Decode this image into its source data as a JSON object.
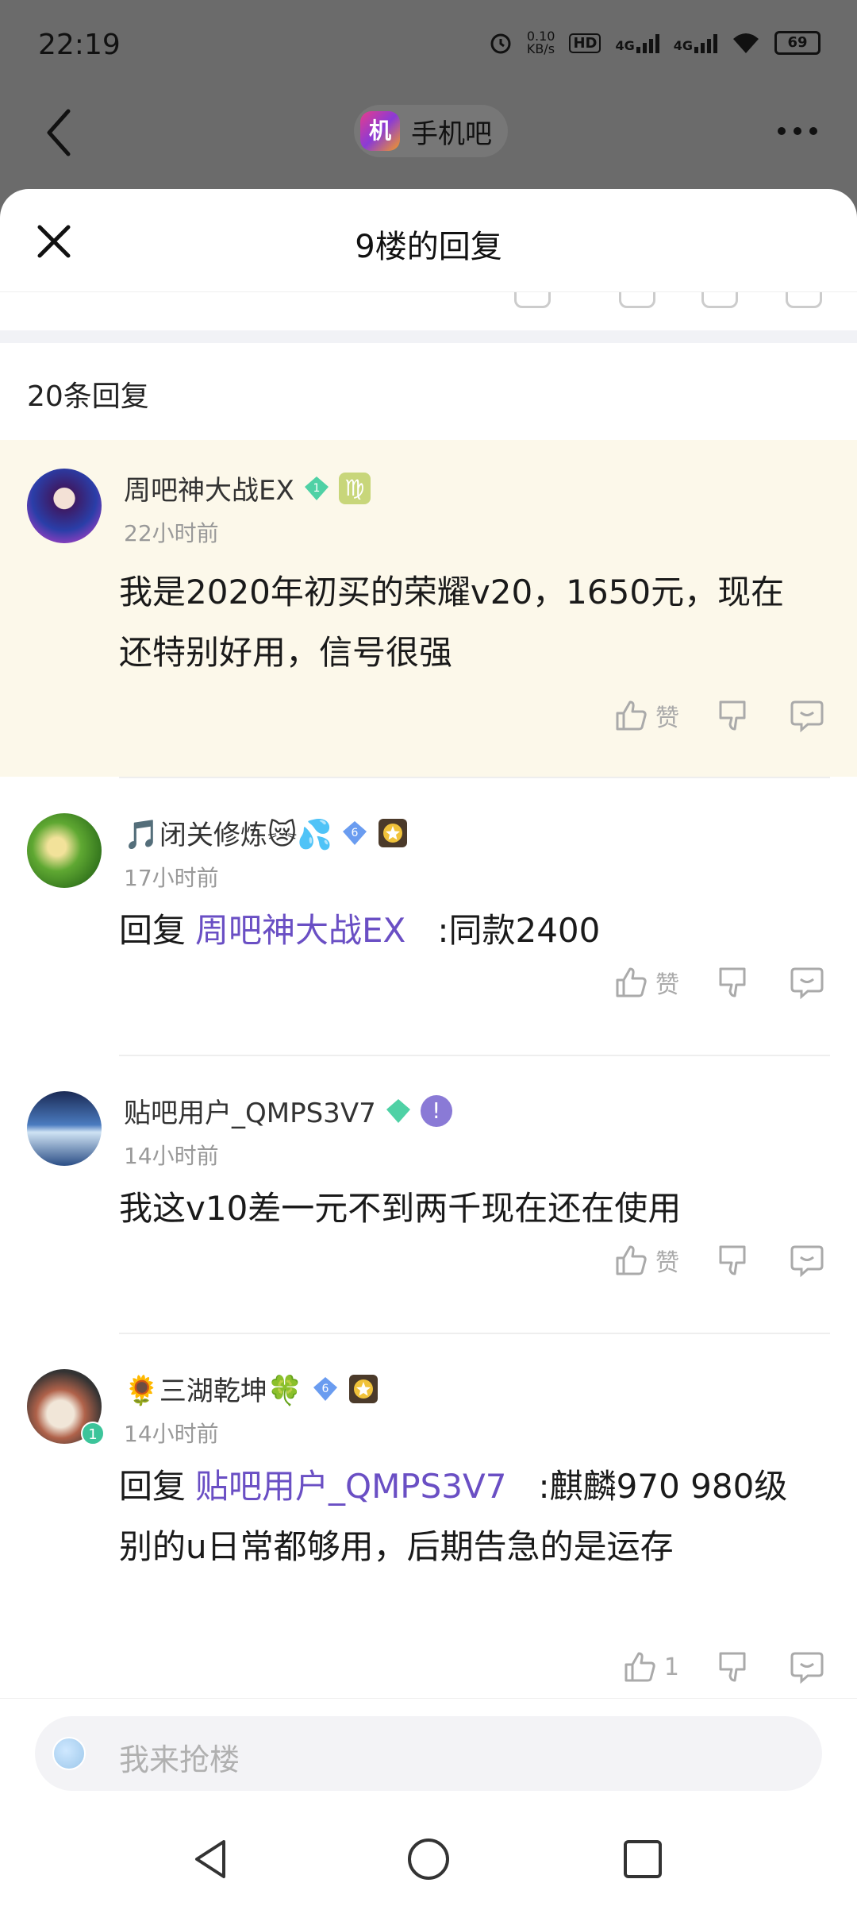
{
  "status_bar": {
    "time": "22:19",
    "net_speed": "0.10\nKB/s",
    "hd": "HD",
    "sim1": "4G",
    "sim2": "4G",
    "battery": "69"
  },
  "header": {
    "forum_logo_char": "机",
    "forum_name": "手机吧"
  },
  "sheet": {
    "title": "9楼的回复",
    "count_label": "20条回复"
  },
  "replies": [
    {
      "username": "周吧神大战EX",
      "time": "22小时前",
      "content": "我是2020年初买的荣耀v20，1650元，现在还特别好用，信号很强",
      "like_label": "赞",
      "badge_glyph": "♍",
      "highlighted": true
    },
    {
      "username_prefix": "🎵",
      "username": "闭关修炼",
      "username_suffix": "😿💦",
      "level": "6",
      "time": "17小时前",
      "reply_prefix": "回复",
      "mention": "周吧神大战EX",
      "content": ":同款2400",
      "like_label": "赞"
    },
    {
      "username": "贴吧用户_QMPS3V7",
      "time": "14小时前",
      "content": "我这v10差一元不到两千现在还在使用",
      "like_label": "赞",
      "badge_glyph": "!"
    },
    {
      "username_prefix": "🌻",
      "username": "三湖乾坤",
      "username_suffix": "🍀",
      "level": "6",
      "avatar_level": "1",
      "time": "14小时前",
      "reply_prefix": "回复",
      "mention": "贴吧用户_QMPS3V7",
      "content": ":麒麟970 980级别的u日常都够用，后期告急的是运存",
      "like_count": "1"
    }
  ],
  "composer": {
    "placeholder": "我来抢楼"
  },
  "colors": {
    "mention": "#6a4fc4",
    "highlight_bg": "#fcf8ea",
    "level_green": "#4fd1a5",
    "level_blue": "#6a9cf0"
  }
}
